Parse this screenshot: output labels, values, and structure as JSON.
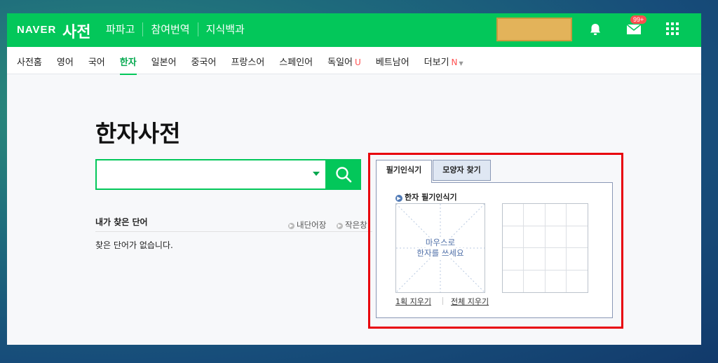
{
  "header": {
    "logo": "NAVER",
    "brand": "사전",
    "links": [
      "파파고",
      "참여번역",
      "지식백과"
    ],
    "mail_badge": "99+",
    "icons": [
      "bell-icon",
      "mail-icon",
      "apps-grid-icon"
    ],
    "accent_color": "#03c75a"
  },
  "nav": {
    "items": [
      {
        "label": "사전홈",
        "mark": ""
      },
      {
        "label": "영어",
        "mark": ""
      },
      {
        "label": "국어",
        "mark": ""
      },
      {
        "label": "한자",
        "mark": ""
      },
      {
        "label": "일본어",
        "mark": ""
      },
      {
        "label": "중국어",
        "mark": ""
      },
      {
        "label": "프랑스어",
        "mark": ""
      },
      {
        "label": "스페인어",
        "mark": ""
      },
      {
        "label": "독일어",
        "mark": "U"
      },
      {
        "label": "베트남어",
        "mark": ""
      },
      {
        "label": "더보기",
        "mark": "N"
      }
    ],
    "active": "한자"
  },
  "main": {
    "title": "한자사전",
    "search": {
      "value": "",
      "placeholder": ""
    },
    "recent": {
      "title": "내가 찾은 단어",
      "links": [
        "내단어장",
        "작은창"
      ],
      "empty": "찾은 단어가 없습니다."
    }
  },
  "handwriting": {
    "tabs": [
      "필기인식기",
      "모양자 찾기"
    ],
    "active_tab": "필기인식기",
    "panel_title": "한자 필기인식기",
    "hint": [
      "마우스로",
      "한자를 쓰세요"
    ],
    "clear_one": "1획 지우기",
    "clear_all": "전체 지우기",
    "highlight_color": "#e8000b"
  }
}
